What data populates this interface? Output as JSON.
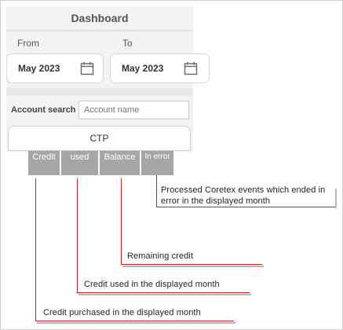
{
  "header": {
    "title": "Dashboard"
  },
  "date_range": {
    "from_label": "From",
    "from_value": "May 2023",
    "to_label": "To",
    "to_value": "May 2023"
  },
  "search": {
    "label": "Account search",
    "placeholder": "Account name"
  },
  "tab": {
    "label": "CTP"
  },
  "columns": [
    {
      "label": "Credit"
    },
    {
      "label": "used"
    },
    {
      "label": "Balance"
    },
    {
      "label": "In error"
    }
  ],
  "callouts": {
    "in_error": "Processed Coretex events which ended in error in the displayed month",
    "balance": "Remaining  credit",
    "used": "Credit used in the displayed month",
    "credit": "Credit purchased in the displayed month"
  },
  "colors": {
    "accent_line": "#cc2222",
    "column_header_bg": "#a6a6a6"
  }
}
